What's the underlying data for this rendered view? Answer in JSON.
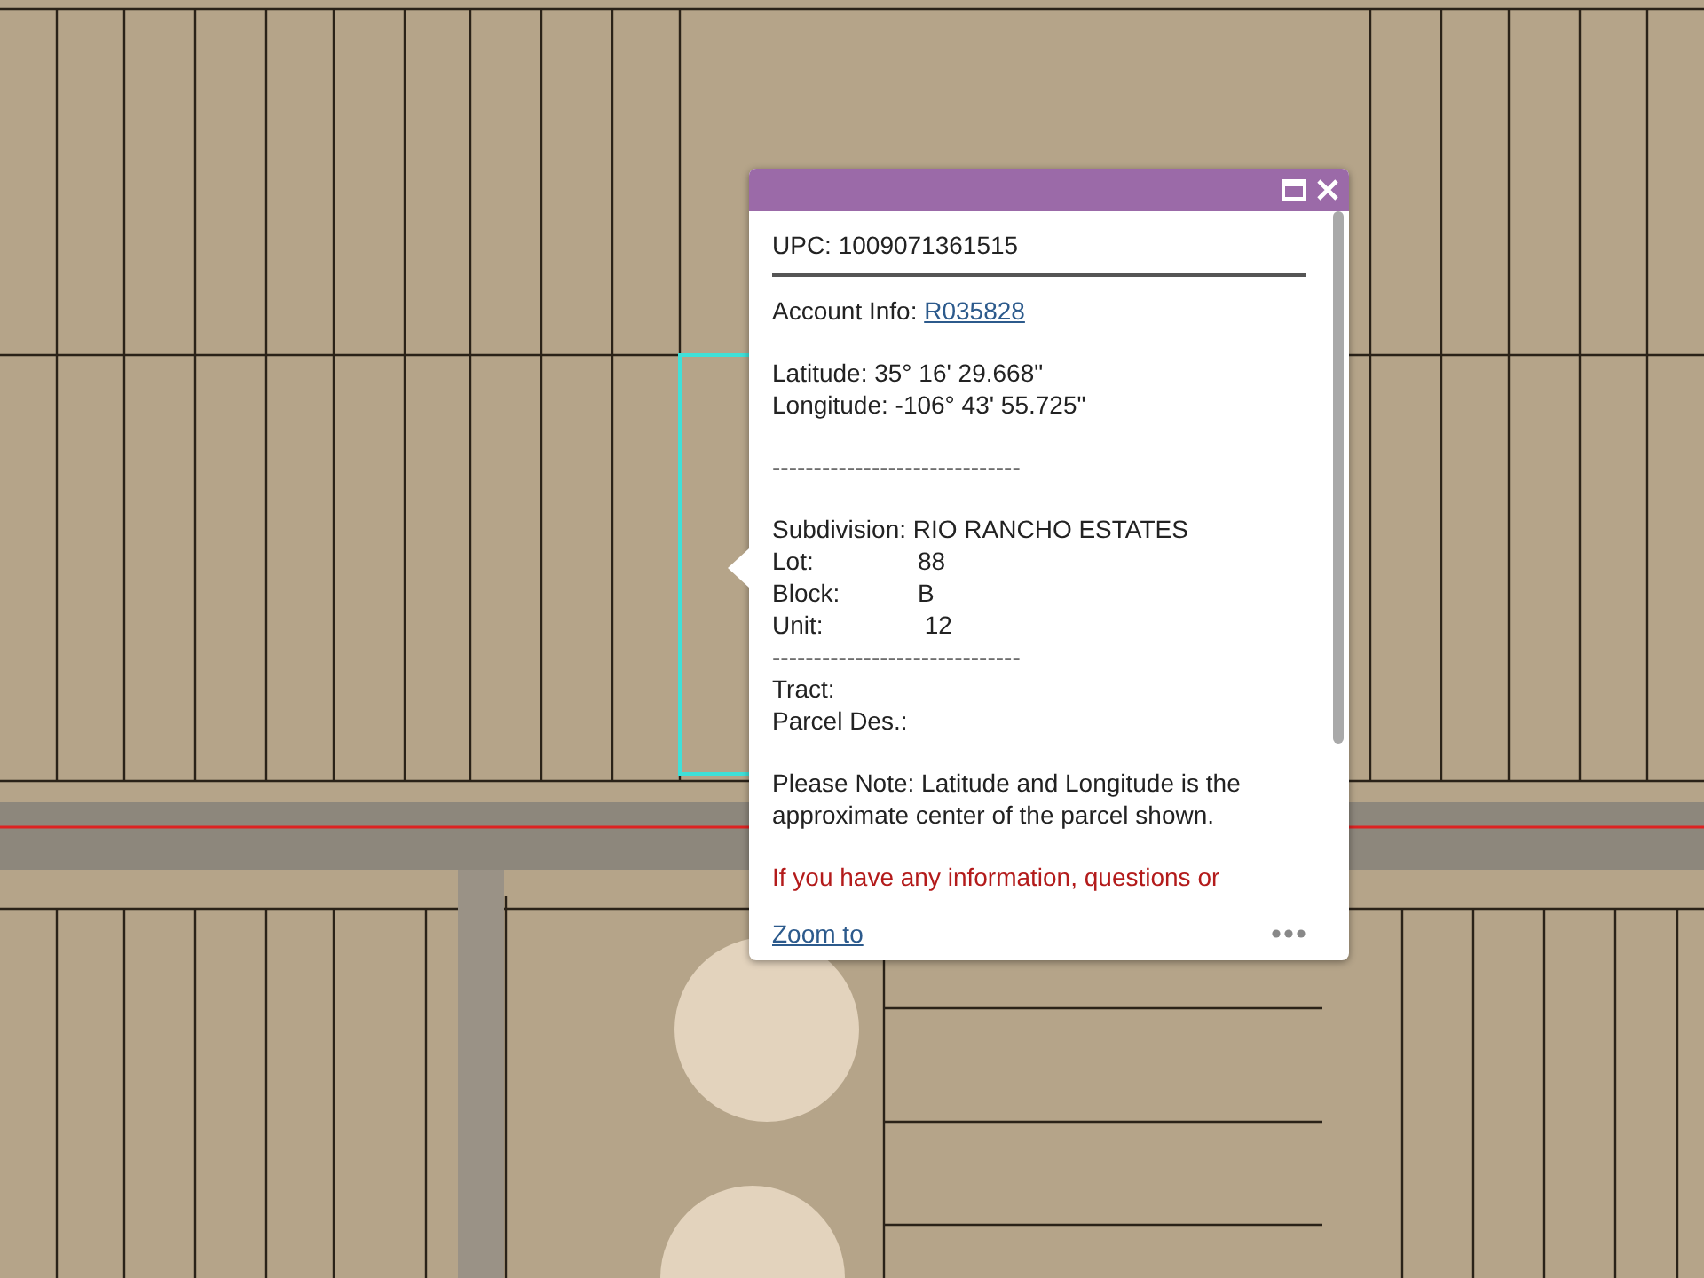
{
  "popup": {
    "sections": [
      {
        "lines": [
          {
            "kind": "heading",
            "text": "UPC: 1009071361515"
          }
        ]
      },
      {
        "lines": [
          {
            "kind": "link",
            "label": "Account Info:",
            "link": "R035828"
          }
        ]
      },
      {
        "lines": [
          {
            "kind": "text",
            "text": "Latitude: 35° 16' 29.668\""
          },
          {
            "kind": "text",
            "text": "Longitude: -106° 43' 55.725\""
          }
        ]
      },
      {
        "lines": [
          {
            "kind": "text",
            "text": "------------------------------"
          }
        ]
      },
      {
        "lines": [
          {
            "kind": "text",
            "text": "Subdivision: RIO RANCHO ESTATES"
          },
          {
            "kind": "pair",
            "label": "Lot:",
            "value": "88"
          },
          {
            "kind": "pair",
            "label": "Block:",
            "value": "B"
          },
          {
            "kind": "pair",
            "label": "Unit:",
            "value": " 12"
          },
          {
            "kind": "text",
            "text": "------------------------------"
          },
          {
            "kind": "text",
            "text": "Tract:"
          },
          {
            "kind": "text",
            "text": "Parcel Des.:"
          }
        ]
      },
      {
        "lines": [
          {
            "kind": "note",
            "text": "Please Note: Latitude and Longitude is the approximate center of the parcel shown."
          }
        ]
      },
      {
        "lines": [
          {
            "kind": "warning",
            "text": "If you have any information, questions or"
          }
        ]
      }
    ],
    "footer": {
      "action": "Zoom to"
    }
  }
}
